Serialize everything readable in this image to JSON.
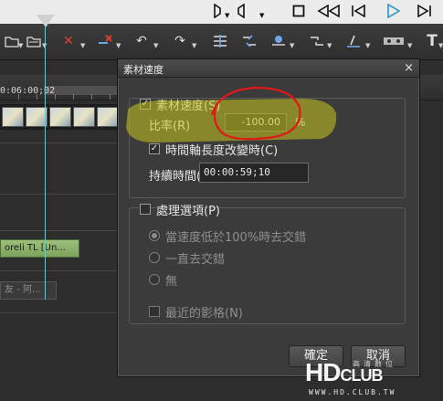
{
  "transport": {
    "icons": [
      "mark-in-icon",
      "mark-out-icon",
      "stop-icon",
      "rewind-icon",
      "step-back-icon",
      "play-icon",
      "step-forward-icon"
    ],
    "colors": {
      "play": "#3ba0c8"
    }
  },
  "toolbar": {
    "icons": [
      "open-bin-icon",
      "open-folder-icon",
      "delete-icon",
      "ripple-delete-icon",
      "undo-icon",
      "redo-icon",
      "add-cut-icon",
      "cut-edit-icon",
      "marker-icon",
      "link-icon",
      "color-adjust-icon",
      "tape-icon",
      "title-icon"
    ]
  },
  "timeline": {
    "timecode": "0:06:00;02",
    "clip1_label": "oreli  TL [Un...",
    "clip2_label": "友 - 阿..."
  },
  "dialog": {
    "title": "素材速度",
    "close_glyph": "×",
    "speed_group": {
      "checkbox_label": "素材速度(S)",
      "checked": true,
      "ratio_label": "比率(R)",
      "ratio_value": "-100.00",
      "ratio_unit": "%",
      "timeline_length_label": "時間軸長度改變時(C)",
      "timeline_length_checked": true,
      "duration_label": "持續時間(D)",
      "duration_value": "00:00:59;10"
    },
    "process_group": {
      "checkbox_label": "處理選項(P)",
      "checked": false,
      "options": [
        "當速度低於100%時去交錯",
        "一直去交錯",
        "無"
      ],
      "selected_index": 0,
      "nearest_frame_label": "最近的影格(N)",
      "nearest_frame_checked": false
    },
    "ok_label": "確定",
    "cancel_label": "取消"
  },
  "annotation": {
    "highlight_color": "#c8c81e",
    "circle_color": "#e01818"
  },
  "watermark": {
    "logo": "HD",
    "logo_small": "CLUB",
    "subtitle": "高清數位",
    "url": "WWW.HD.CLUB.TW"
  }
}
